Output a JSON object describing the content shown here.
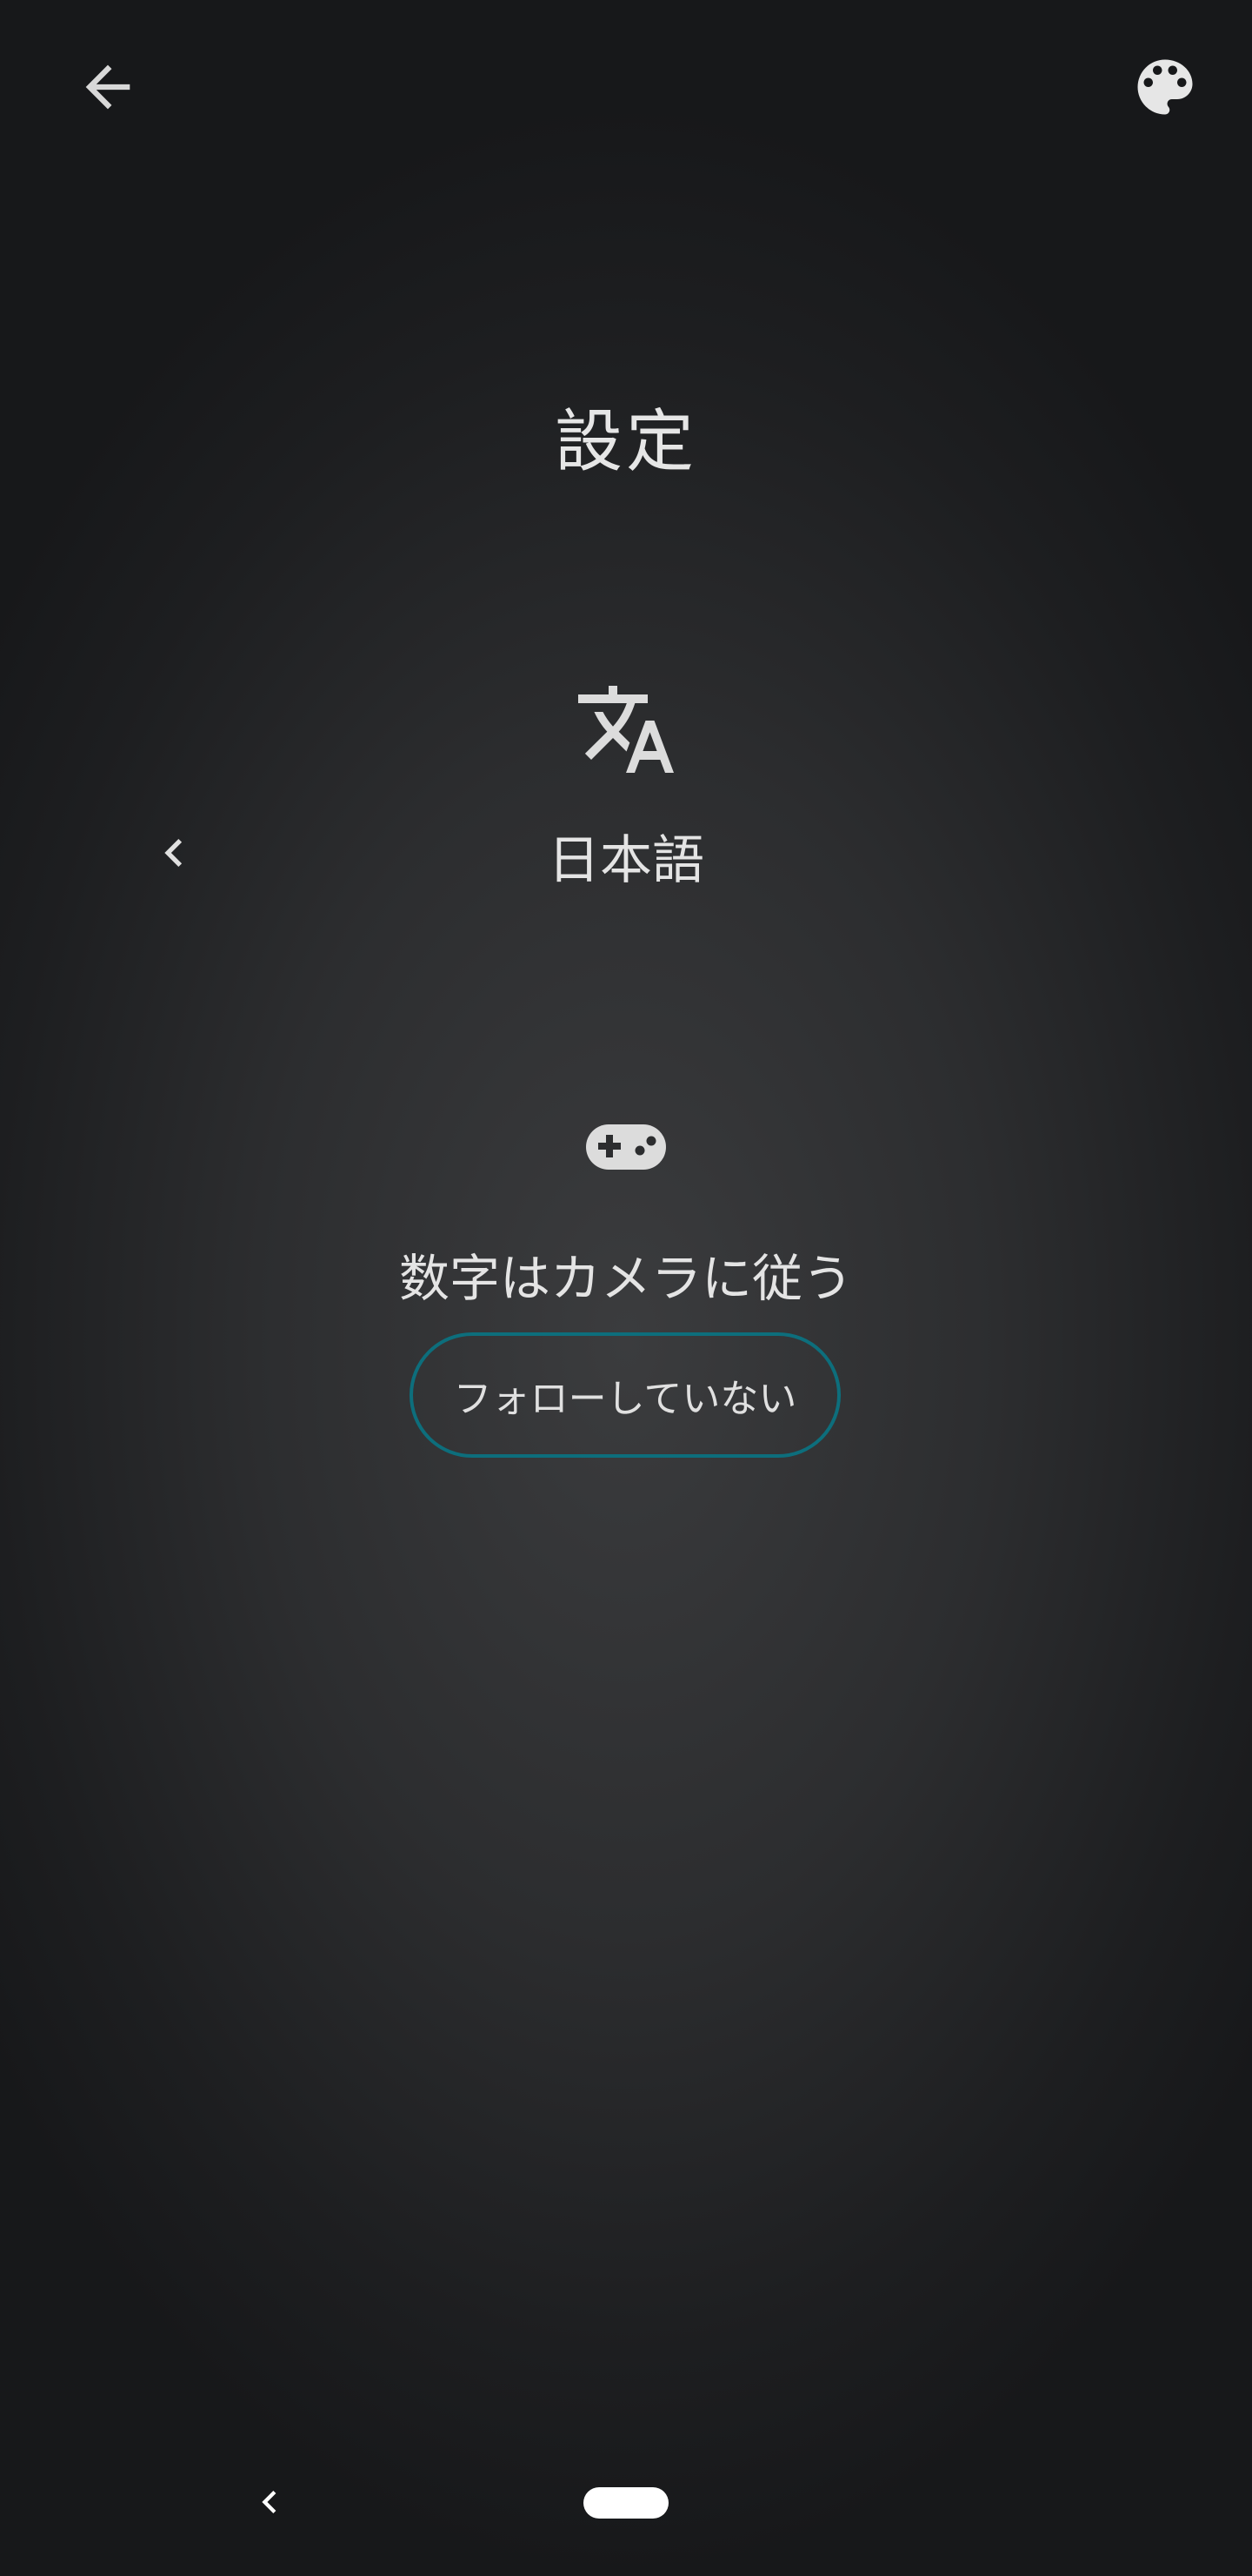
{
  "header": {
    "back_icon": "arrow-back-icon",
    "theme_icon": "palette-icon"
  },
  "title": "設定",
  "language_setting": {
    "icon": "translate-icon",
    "prev_icon": "chevron-left-icon",
    "value": "日本語"
  },
  "number_follow_setting": {
    "icon": "gamepad-icon",
    "label": "数字はカメラに従う",
    "button_label": "フォローしていない",
    "button_border_color": "#0d6e7c"
  },
  "navigation_bar": {
    "back_icon": "nav-back-icon",
    "home_icon": "home-pill-icon"
  },
  "colors": {
    "background_center": "#3b3c3e",
    "background_edge": "#17181a",
    "text": "#e4e4e4",
    "accent": "#0d6e7c"
  }
}
